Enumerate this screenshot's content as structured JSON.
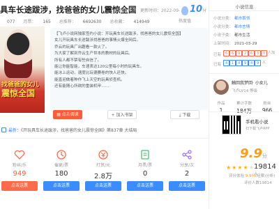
{
  "book": {
    "title": "具车长途跋涉，找爸爸的女儿震惊全国",
    "author_prefix": "小农儿写观",
    "updated": "更新时间：2022-09-",
    "hot_score": "10",
    "hot_unit": "分",
    "hot_label": "热度值",
    "stats": [
      {
        "label": "",
        "value": "077"
      },
      {
        "label": "月票：",
        "value": "165"
      },
      {
        "label": "总推荐：",
        "value": "6692630"
      },
      {
        "label": "总收藏：",
        "value": "414949"
      }
    ]
  },
  "cover": {
    "text_line1": "找爸爸的女儿",
    "text_line2": "震惊全国"
  },
  "intro": {
    "lines": [
      "【飞卢小说网独家签约小说：开玩具车长途跋涉，找爸爸的女儿震惊全国】",
      "女儿开玩具车长途跋涉找爸爸的事情火爆全网后。",
      "乔云的玩具厂出趣看一款火了。",
      "为大家了解到乔云生产世本的教材的玩具后。",
      "所有人都不禁有些自信了。",
      "能让你能智能，车速表达120公里每小时的玩具车。",
      "能冰上运动，速度比玩德赛卷的快人还快。",
      "能直迎做着种作飞上天空的玩具侦查机。",
      "还有能随心所欲的重装机甲……"
    ]
  },
  "actions": {
    "read": "点击阅读",
    "shelf": "加入书架",
    "download": "下载"
  },
  "latest": {
    "label": "最新：",
    "text": "《开玩具车长途跋涉，找爸爸的女儿震惊全国》第837章 大结局"
  },
  "stat_items": [
    {
      "label": "粉丝/乐",
      "value": "949",
      "button": "点击送票",
      "icon": "heart-icon"
    },
    {
      "label": "催更/票",
      "value": "180",
      "button": "点击送票",
      "icon": "clock-icon"
    },
    {
      "label": "打赏/元",
      "value": "2.8万",
      "button": "点击送票",
      "icon": "coin-icon"
    },
    {
      "label": "月票/票",
      "value": "0",
      "button": "点击送票",
      "icon": "ticket-icon"
    },
    {
      "label": "分享/次",
      "value": "2",
      "button": "点击送票",
      "icon": "share-icon"
    }
  ],
  "rating": {
    "score": "9.9",
    "score_unit": "分",
    "votes": "19814",
    "votes_unit": "人",
    "sub1_prefix": "评分体验",
    "sub1_value": "9.9分",
    "sub1_suffix": "(经票)分析)",
    "sub2": "评价人数19814"
  },
  "sidebar": {
    "header": "小说信息",
    "rows": [
      {
        "label": "小说分类：",
        "value": "都市首领"
      },
      {
        "label": "小说分类：",
        "value": "都市言情"
      },
      {
        "label": "小说子类：",
        "value": "都市生活"
      },
      {
        "label": "上架时间：",
        "value": "2021-03-29"
      }
    ],
    "tag_label": "已有",
    "tags": [
      "6",
      "6",
      "9",
      "2",
      "6",
      "3",
      "0"
    ],
    "tag_end": "人加",
    "tag2_label": "已有",
    "tag2_values": [
      "4",
      "1",
      "4",
      "9",
      "4",
      "9"
    ],
    "tag2_end": "人",
    "author_name": "触回我梦回· 小女儿",
    "author_level": "飞卢LV14 等级",
    "author_stats": [
      {
        "label": "作品",
        "value": "1"
      },
      {
        "label": "累计字数",
        "value": "184万"
      },
      {
        "label": "粉丝",
        "value": "966"
      }
    ],
    "qr_title": "手机看小说",
    "qr_sub": "扫下载飞卢APP"
  }
}
